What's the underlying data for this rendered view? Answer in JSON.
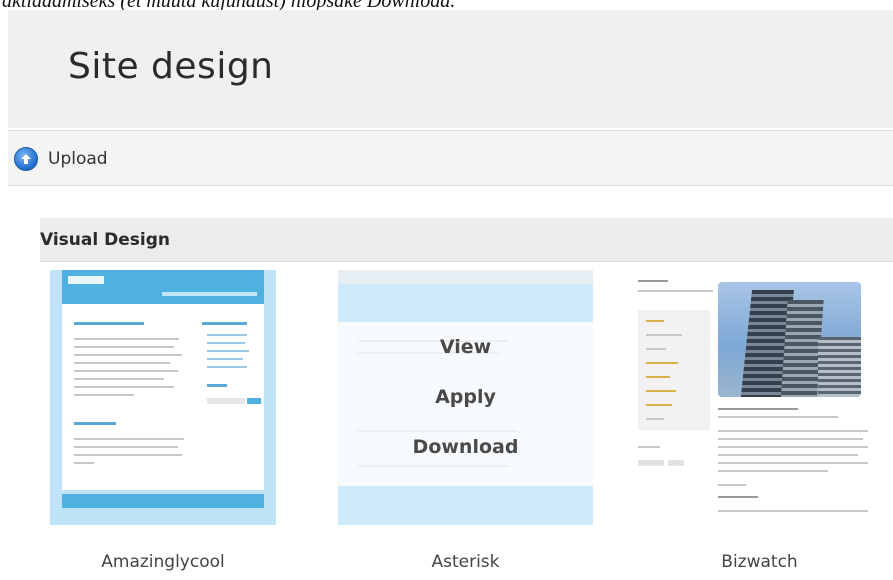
{
  "top_caption": "aktiaadmiseks (et muuta kujundust) niopsake Download.",
  "header": {
    "title": "Site design"
  },
  "toolbar": {
    "upload_label": "Upload"
  },
  "section": {
    "title": "Visual Design",
    "themes": [
      {
        "name": "Amazinglycool",
        "thumb_logo": "ShowTime"
      },
      {
        "name": "Asterisk",
        "actions": [
          "View",
          "Apply",
          "Download"
        ]
      },
      {
        "name": "Bizwatch"
      }
    ]
  },
  "colors": {
    "header_bg": "#f0f0f0",
    "upload_icon": "#1e6bc9",
    "amazinglycool_accent": "#4fb1e0",
    "asterisk_accent": "#cfeafa"
  },
  "icons": {
    "upload": "upload-arrow-circle-icon"
  }
}
